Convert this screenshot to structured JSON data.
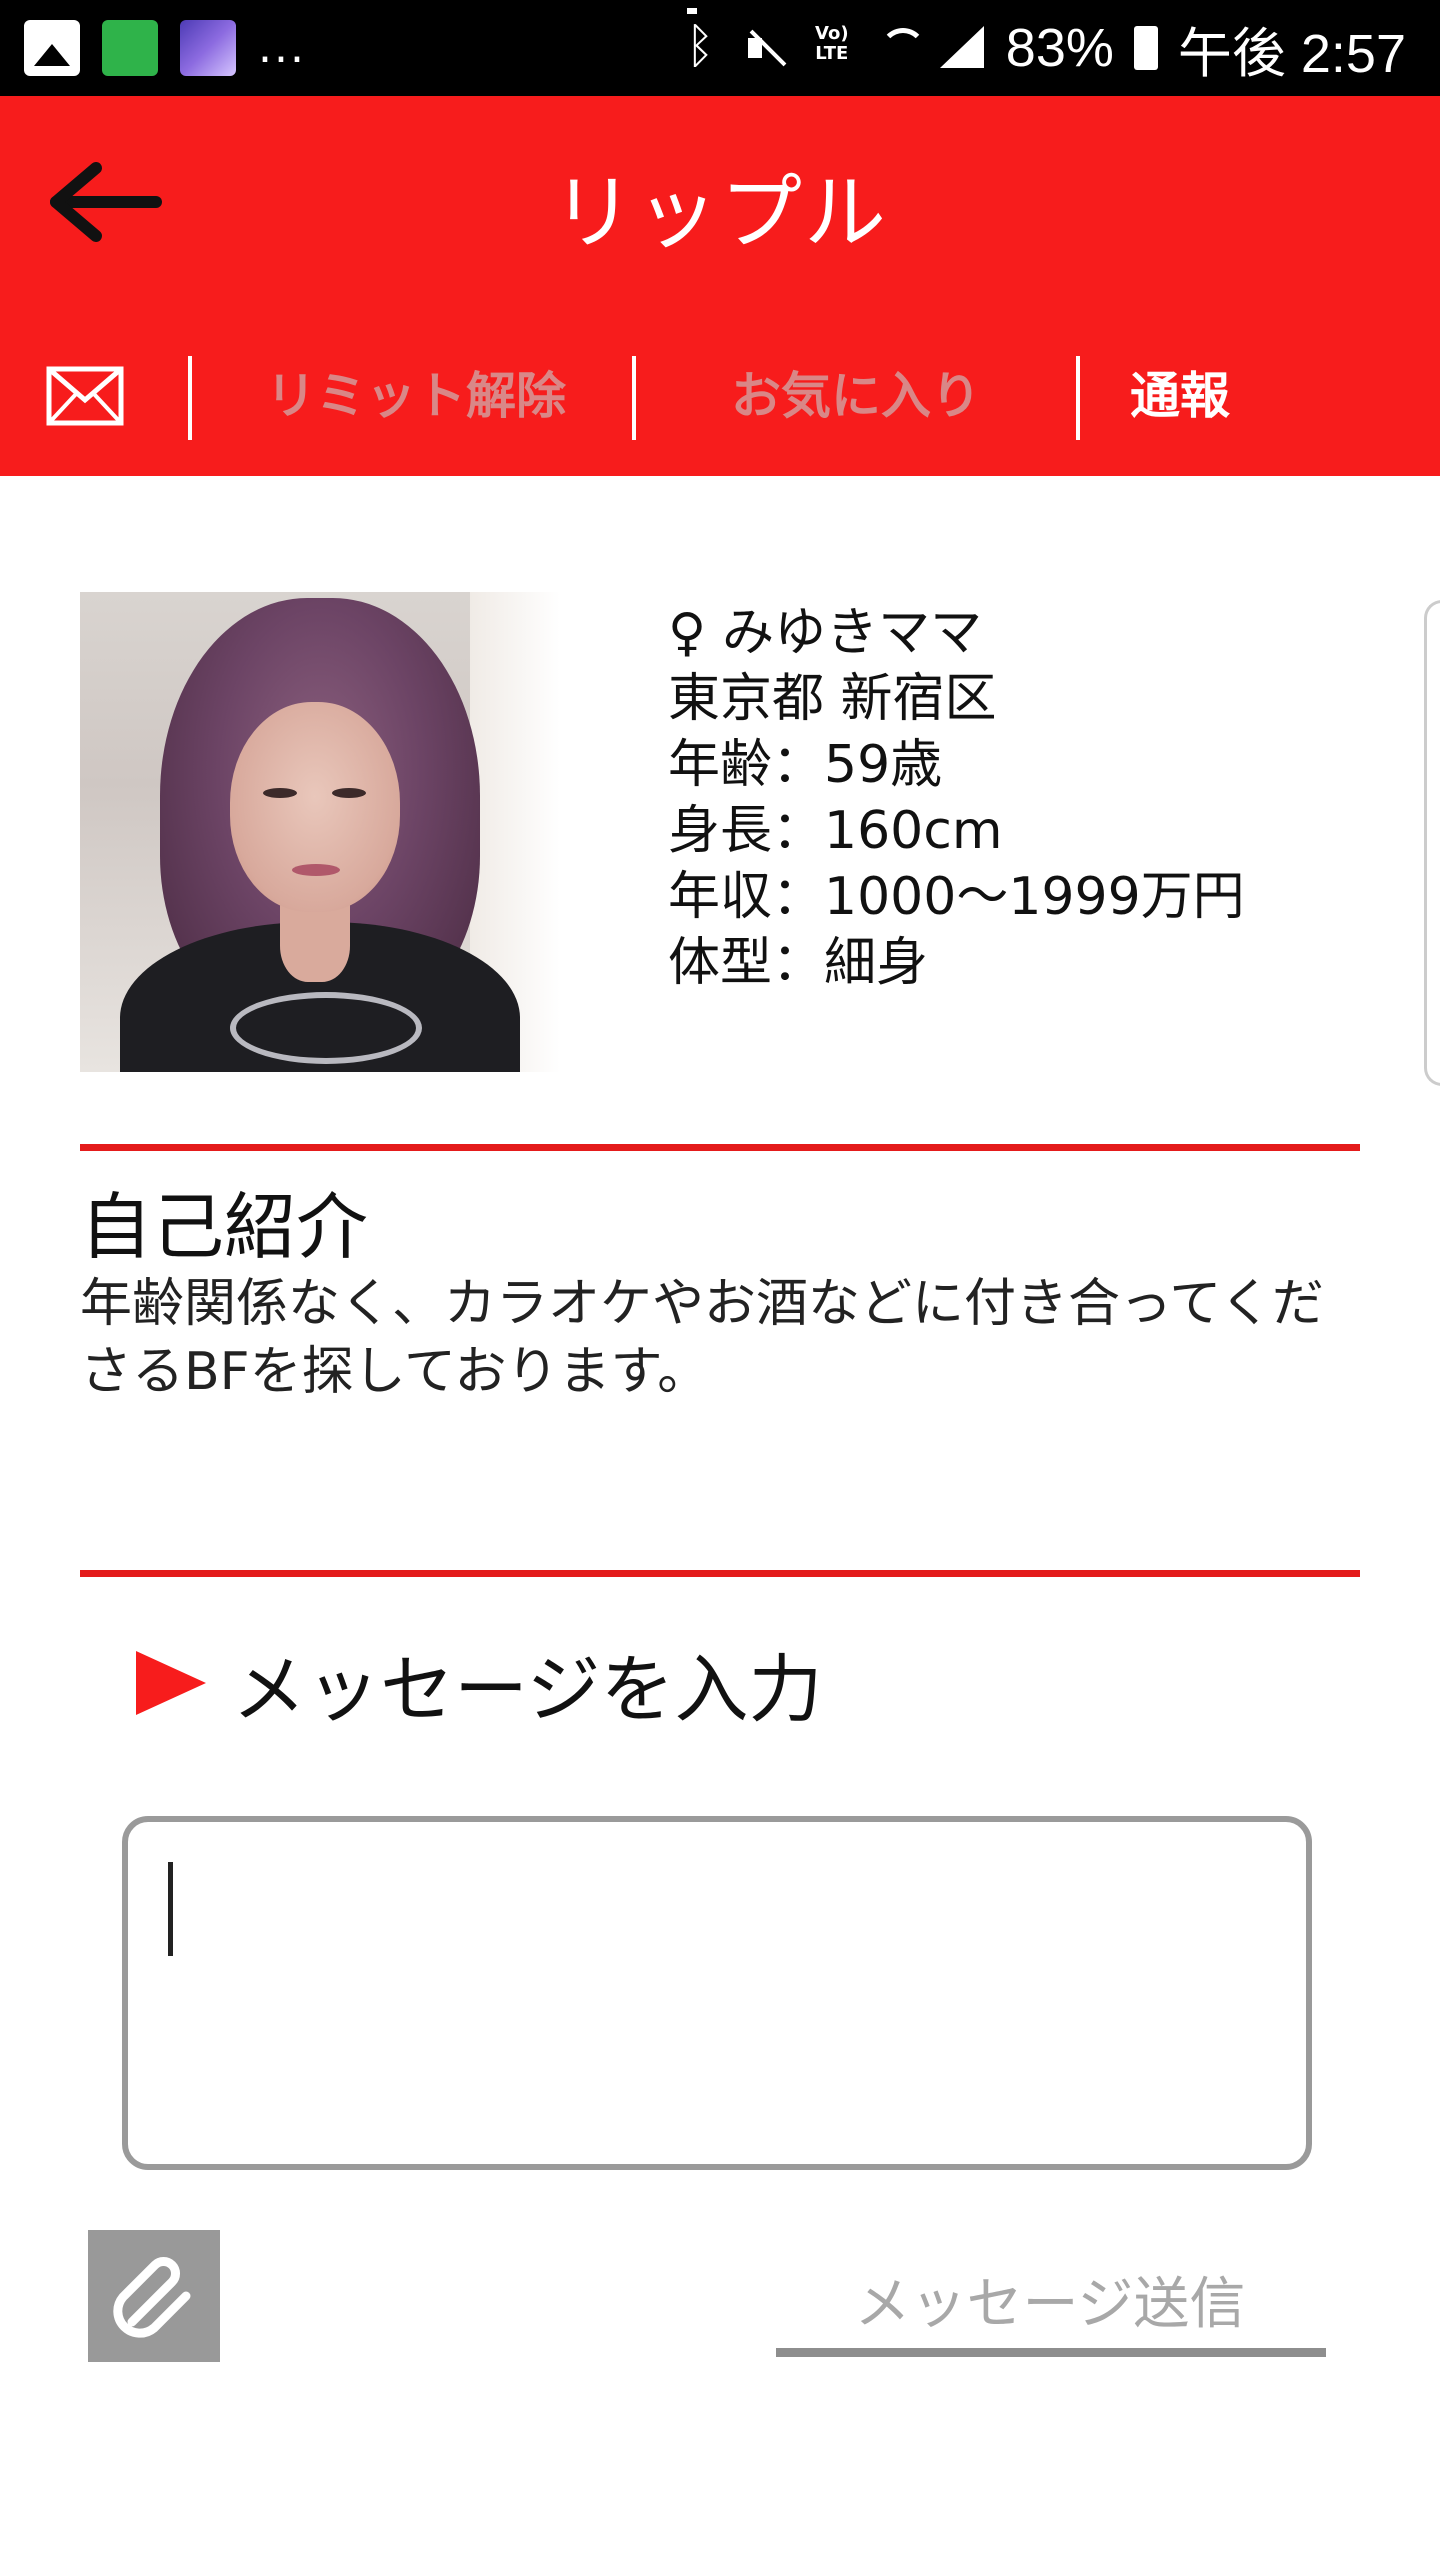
{
  "status_bar": {
    "overflow": "...",
    "battery_percent": "83%",
    "time": "午後 2:57",
    "lte_label": "Vo) LTE"
  },
  "header": {
    "title": "リップル",
    "back_icon": "arrow-left-icon"
  },
  "tabs": {
    "mail_icon": "envelope-icon",
    "limit": "リミット解除",
    "favorite": "お気に入り",
    "report": "通報"
  },
  "profile": {
    "gender_symbol": "♀",
    "name": "みゆきママ",
    "location": "東京都 新宿区",
    "age": "年齢：59歳",
    "height": "身長：160cm",
    "income": "年収：1000〜1999万円",
    "body_type": "体型：細身"
  },
  "intro": {
    "heading": "自己紹介",
    "text": "年齢関係なく、カラオケやお酒などに付き合ってくださるBFを探しております。"
  },
  "message": {
    "heading": "メッセージを入力",
    "input_value": "",
    "send_label": "メッセージ送信",
    "attach_icon": "paperclip-icon"
  },
  "colors": {
    "accent": "#f71c1c",
    "divider": "#e41b1b",
    "tab_inactive": "#d98787"
  }
}
